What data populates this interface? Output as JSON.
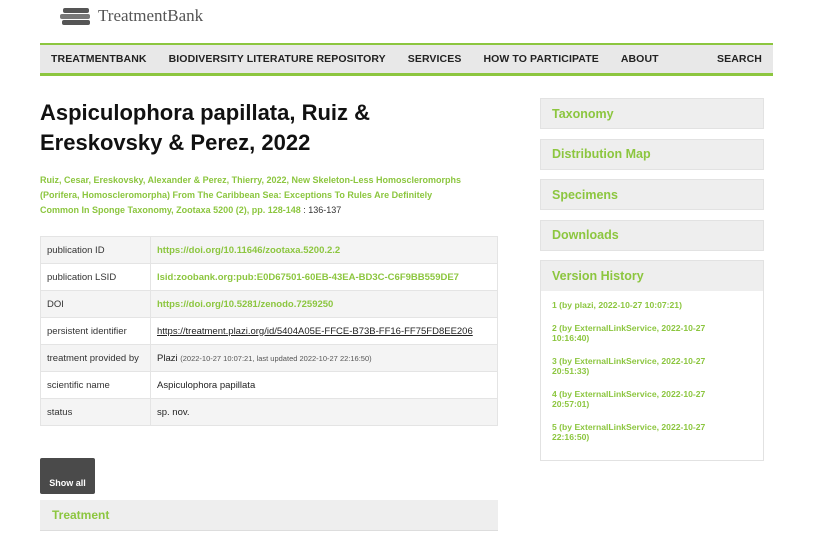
{
  "logo": {
    "text": "TreatmentBank"
  },
  "nav": {
    "items": [
      "TREATMENTBANK",
      "BIODIVERSITY LITERATURE REPOSITORY",
      "SERVICES",
      "HOW TO PARTICIPATE",
      "ABOUT"
    ],
    "search": "SEARCH"
  },
  "main": {
    "title_line1": "Aspiculophora papillata, Ruiz &",
    "title_line2": "Ereskovsky & Perez, 2022",
    "citation_line1": "Ruiz, Cesar, Ereskovsky, Alexander & Perez, Thierry, 2022, New Skeleton-Less Homoscleromorphs",
    "citation_line2": "(Porifera, Homoscleromorpha) From The Caribbean Sea: Exceptions To Rules Are Definitely",
    "citation_line3": "Common In Sponge Taxonomy, Zootaxa 5200 (2), pp. 128-148",
    "citation_pages": " : 136-137",
    "meta": {
      "publication_id": {
        "key": "publication ID",
        "value": "https://doi.org/10.11646/zootaxa.5200.2.2"
      },
      "publication_lsid": {
        "key": "publication LSID",
        "value": "lsid:zoobank.org:pub:E0D67501-60EB-43EA-BD3C-C6F9BB559DE7"
      },
      "doi": {
        "key": "DOI",
        "value": "https://doi.org/10.5281/zenodo.7259250"
      },
      "persistent_identifier": {
        "key": "persistent identifier",
        "value": "https://treatment.plazi.org/id/5404A05E-FFCE-B73B-FF16-FF75FD8EE206"
      },
      "treatment_provided_by": {
        "key": "treatment provided by",
        "value": "Plazi",
        "note": "(2022-10-27 10:07:21, last updated 2022-10-27 22:16:50)"
      },
      "scientific_name": {
        "key": "scientific name",
        "value": "Aspiculophora papillata"
      },
      "status": {
        "key": "status",
        "value": "sp. nov."
      }
    },
    "show_all": "Show all",
    "treatment": "Treatment"
  },
  "side": {
    "taxonomy": "Taxonomy",
    "distribution_map": "Distribution Map",
    "specimens": "Specimens",
    "downloads": "Downloads",
    "version_history": "Version History",
    "versions": [
      {
        "line1": "1 (by plazi, 2022-10-27 10:07:21)",
        "line2": ""
      },
      {
        "line1": "2 (by ExternalLinkService, 2022-10-27",
        "line2": "10:16:40)"
      },
      {
        "line1": "3 (by ExternalLinkService, 2022-10-27",
        "line2": "20:51:33)"
      },
      {
        "line1": "4 (by ExternalLinkService, 2022-10-27",
        "line2": "20:57:01)"
      },
      {
        "line1": "5 (by ExternalLinkService, 2022-10-27",
        "line2": "22:16:50)"
      }
    ]
  },
  "colors": {
    "accent": "#8cc63f",
    "nav_bg": "#e8e8e8",
    "button_dark": "#4a4a4a"
  },
  "icons": {
    "logo": "books-icon"
  }
}
